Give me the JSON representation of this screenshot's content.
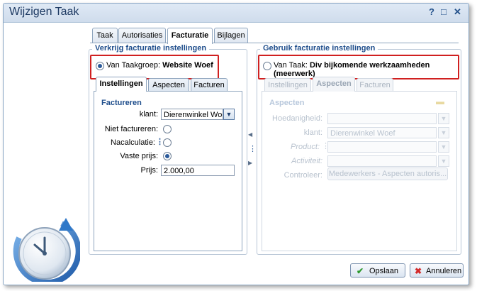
{
  "window": {
    "title": "Wijzigen Taak",
    "help": "?",
    "maximize": "□",
    "close": "✕"
  },
  "tabs": [
    {
      "label": "Taak"
    },
    {
      "label": "Autorisaties"
    },
    {
      "label": "Facturatie",
      "active": true
    },
    {
      "label": "Bijlagen"
    }
  ],
  "left": {
    "legend": "Verkrijg facturatie instellingen",
    "option_prefix": "Van Taakgroep:",
    "option_value": "Website Woef",
    "subtabs": [
      "Instellingen",
      "Aspecten",
      "Facturen"
    ],
    "section": "Factureren",
    "klant_label": "klant:",
    "klant_value": "Dierenwinkel Woef",
    "niet_label": "Niet factureren:",
    "nacalc_label": "Nacalculatie:",
    "vaste_label": "Vaste prijs:",
    "prijs_label": "Prijs:",
    "prijs_value": "2.000,00"
  },
  "right": {
    "legend": "Gebruik facturatie instellingen",
    "option_prefix": "Van Taak:",
    "option_value": "Div bijkomende werkzaamheden (meerwerk)",
    "subtabs": [
      "Instellingen",
      "Aspecten",
      "Facturen"
    ],
    "section": "Aspecten",
    "hoedanigheid_label": "Hoedanigheid:",
    "klant_label": "klant:",
    "klant_value": "Dierenwinkel Woef",
    "product_label": "Product:",
    "activiteit_label": "Activiteit:",
    "controleer_label": "Controleer:",
    "controleer_button": "Medewerkers - Aspecten autoris..."
  },
  "buttons": {
    "save": "Opslaan",
    "cancel": "Annuleren"
  }
}
